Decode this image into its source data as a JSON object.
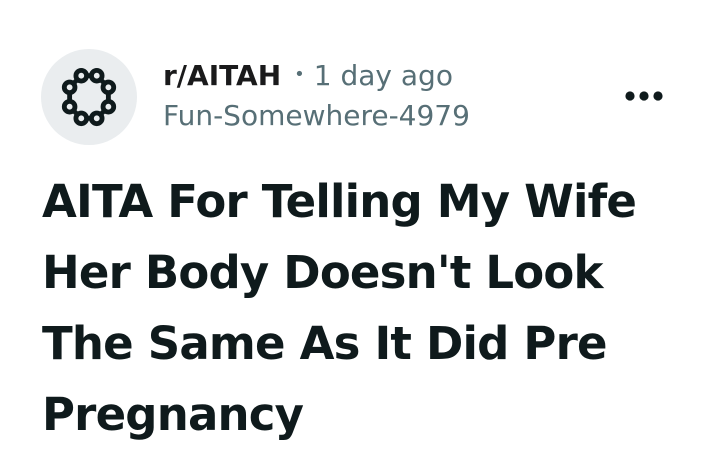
{
  "post": {
    "subreddit": "r/AITAH",
    "separator": "•",
    "timestamp": "1 day ago",
    "author": "Fun-Somewhere-4979",
    "title": "AITA For Telling My Wife Her Body Doesn't Look The Same As It Did Pre Pregnancy",
    "avatar_icon": "subreddit-ring-icon",
    "more_icon": "more-options-icon"
  },
  "colors": {
    "background": "#ffffff",
    "avatar_bg": "#eaedef",
    "primary_text": "#0f1a1c",
    "secondary_text": "#576f76"
  }
}
